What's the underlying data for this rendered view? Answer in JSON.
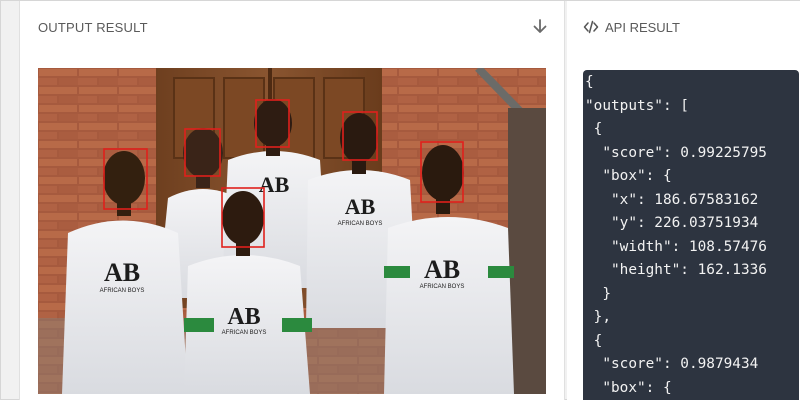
{
  "output_panel": {
    "title": "OUTPUT RESULT",
    "download_icon": "download-arrow-icon",
    "image_alt": "Group photo of six young men in AB African Boys t-shirts with face detection boxes"
  },
  "shirt_print": {
    "logo": "AB",
    "text": "AFRICAN BOYS"
  },
  "api_panel": {
    "icon": "code-brackets-icon",
    "title": "API RESULT",
    "lines": [
      "{",
      "  \"outputs\": [",
      "    {",
      "      \"score\": 0.99225795",
      "      \"box\": {",
      "        \"x\": 186.67583162",
      "        \"y\": 226.03751934",
      "        \"width\": 108.57476",
      "        \"height\": 162.1336",
      "      }",
      "    },",
      "    {",
      "      \"score\": 0.9879434",
      "      \"box\": {"
    ]
  },
  "colors": {
    "code_bg": "#2d3440",
    "box_red": "#e0201c",
    "brick": "#a0553a",
    "door": "#7a4a26"
  }
}
